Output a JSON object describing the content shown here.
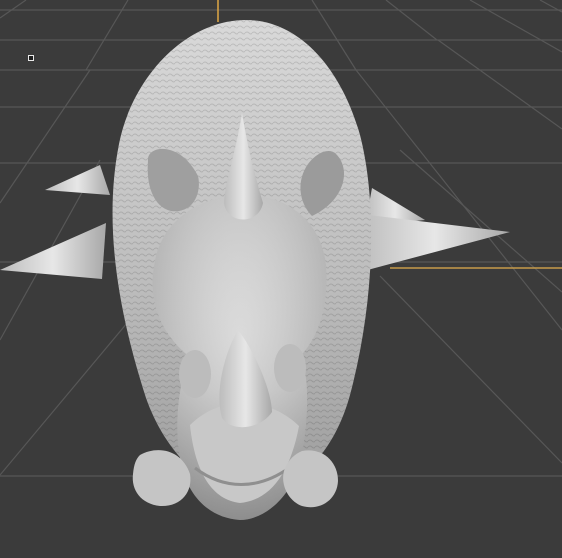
{
  "viewport": {
    "background_color": "#3b3b3b",
    "grid_color": "#5a5a5a",
    "axis_color_vertical": "#c79b4b",
    "axis_color_horizontal": "#c39a56",
    "model_name_icon": "rhino-model",
    "selection_handle_icon": "square-handle-icon"
  }
}
